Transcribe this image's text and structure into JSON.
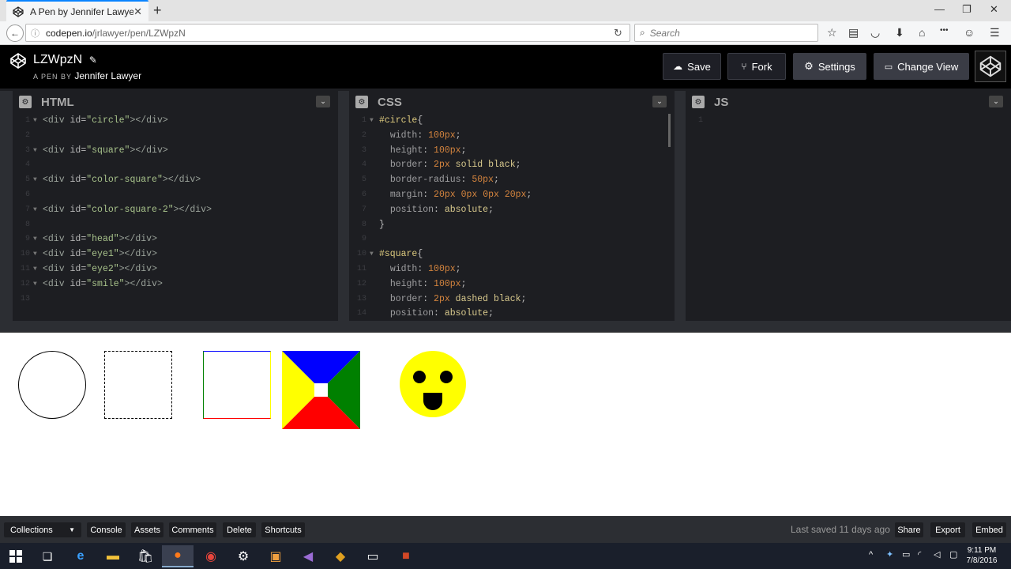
{
  "browser": {
    "tab_title": "A Pen by Jennifer Lawyer",
    "url_host": "codepen.io",
    "url_path": "/jrlawyer/pen/LZWpzN",
    "search_placeholder": "Search"
  },
  "codepen": {
    "pen_title": "LZWpzN",
    "pen_by_label": "A PEN BY",
    "author": "Jennifer Lawyer",
    "buttons": {
      "save": "Save",
      "fork": "Fork",
      "settings": "Settings",
      "change_view": "Change View"
    }
  },
  "editors": {
    "html_title": "HTML",
    "css_title": "CSS",
    "js_title": "JS",
    "html_lines": [
      "<div id=\"circle\"></div>",
      "",
      "<div id=\"square\"></div>",
      "",
      "<div id=\"color-square\"></div>",
      "",
      "<div id=\"color-square-2\"></div>",
      "",
      "<div id=\"head\"></div>",
      "<div id=\"eye1\"></div>",
      "<div id=\"eye2\"></div>",
      "<div id=\"smile\"></div>",
      ""
    ],
    "css_lines": [
      "#circle{",
      "  width: 100px;",
      "  height: 100px;",
      "  border: 2px solid black;",
      "  border-radius: 50px;",
      "  margin: 20px 0px 0px 20px;",
      "  position: absolute;",
      "}",
      "",
      "#square{",
      "  width: 100px;",
      "  height: 100px;",
      "  border: 2px dashed black;",
      "  position: absolute;"
    ],
    "js_lines": [
      ""
    ]
  },
  "footer": {
    "collections": "Collections",
    "console": "Console",
    "assets": "Assets",
    "comments": "Comments",
    "delete": "Delete",
    "shortcuts": "Shortcuts",
    "last_saved": "Last saved 11 days ago",
    "share": "Share",
    "export": "Export",
    "embed": "Embed"
  },
  "taskbar": {
    "time": "9:11 PM",
    "date": "7/8/2016"
  },
  "colors": {
    "codepen_header": "#000000",
    "editor_bg": "#1d1e22",
    "smiley": "#ffff00"
  }
}
